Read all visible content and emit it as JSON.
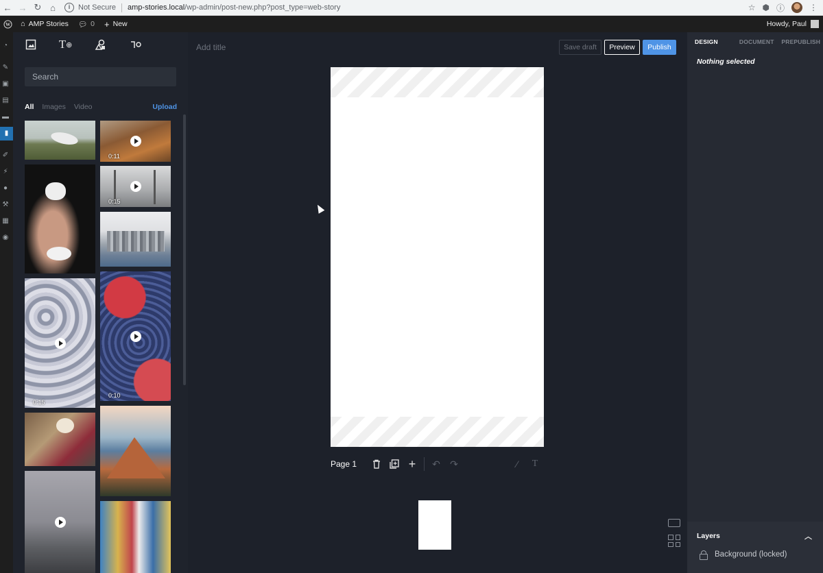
{
  "browser": {
    "security_label": "Not Secure",
    "url_host": "amp-stories.local",
    "url_path": "/wp-admin/post-new.php?post_type=web-story"
  },
  "adminbar": {
    "site_name": "AMP Stories",
    "comments_count": "0",
    "new_label": "New",
    "howdy": "Howdy, Paul"
  },
  "library": {
    "search_placeholder": "Search",
    "filters": [
      "All",
      "Images",
      "Video"
    ],
    "upload_label": "Upload",
    "media": [
      {
        "kind": "image",
        "desc": "crane-bird"
      },
      {
        "kind": "video",
        "duration": "0:11",
        "desc": "canyon-road"
      },
      {
        "kind": "image",
        "desc": "hand-flower"
      },
      {
        "kind": "video",
        "duration": "0:15",
        "desc": "golden-gate"
      },
      {
        "kind": "image",
        "desc": "city-skyline"
      },
      {
        "kind": "video",
        "duration": "0:15",
        "desc": "blossom-tree"
      },
      {
        "kind": "video",
        "duration": "0:10",
        "desc": "berries"
      },
      {
        "kind": "image",
        "desc": "picnic"
      },
      {
        "kind": "image",
        "desc": "mountain"
      },
      {
        "kind": "video",
        "duration": "",
        "desc": "city-fog"
      },
      {
        "kind": "image",
        "desc": "street"
      }
    ]
  },
  "editor": {
    "title_placeholder": "Add title",
    "save_draft": "Save draft",
    "preview": "Preview",
    "publish": "Publish",
    "page_label": "Page 1"
  },
  "inspector": {
    "tabs": [
      "DESIGN",
      "DOCUMENT",
      "PREPUBLISH"
    ],
    "empty_state": "Nothing selected",
    "layers_title": "Layers",
    "layers": [
      "Background (locked)"
    ]
  },
  "colors": {
    "accent": "#4f94e6",
    "panel_bg": "#1f232c",
    "canvas_bg": "#1d212a"
  }
}
